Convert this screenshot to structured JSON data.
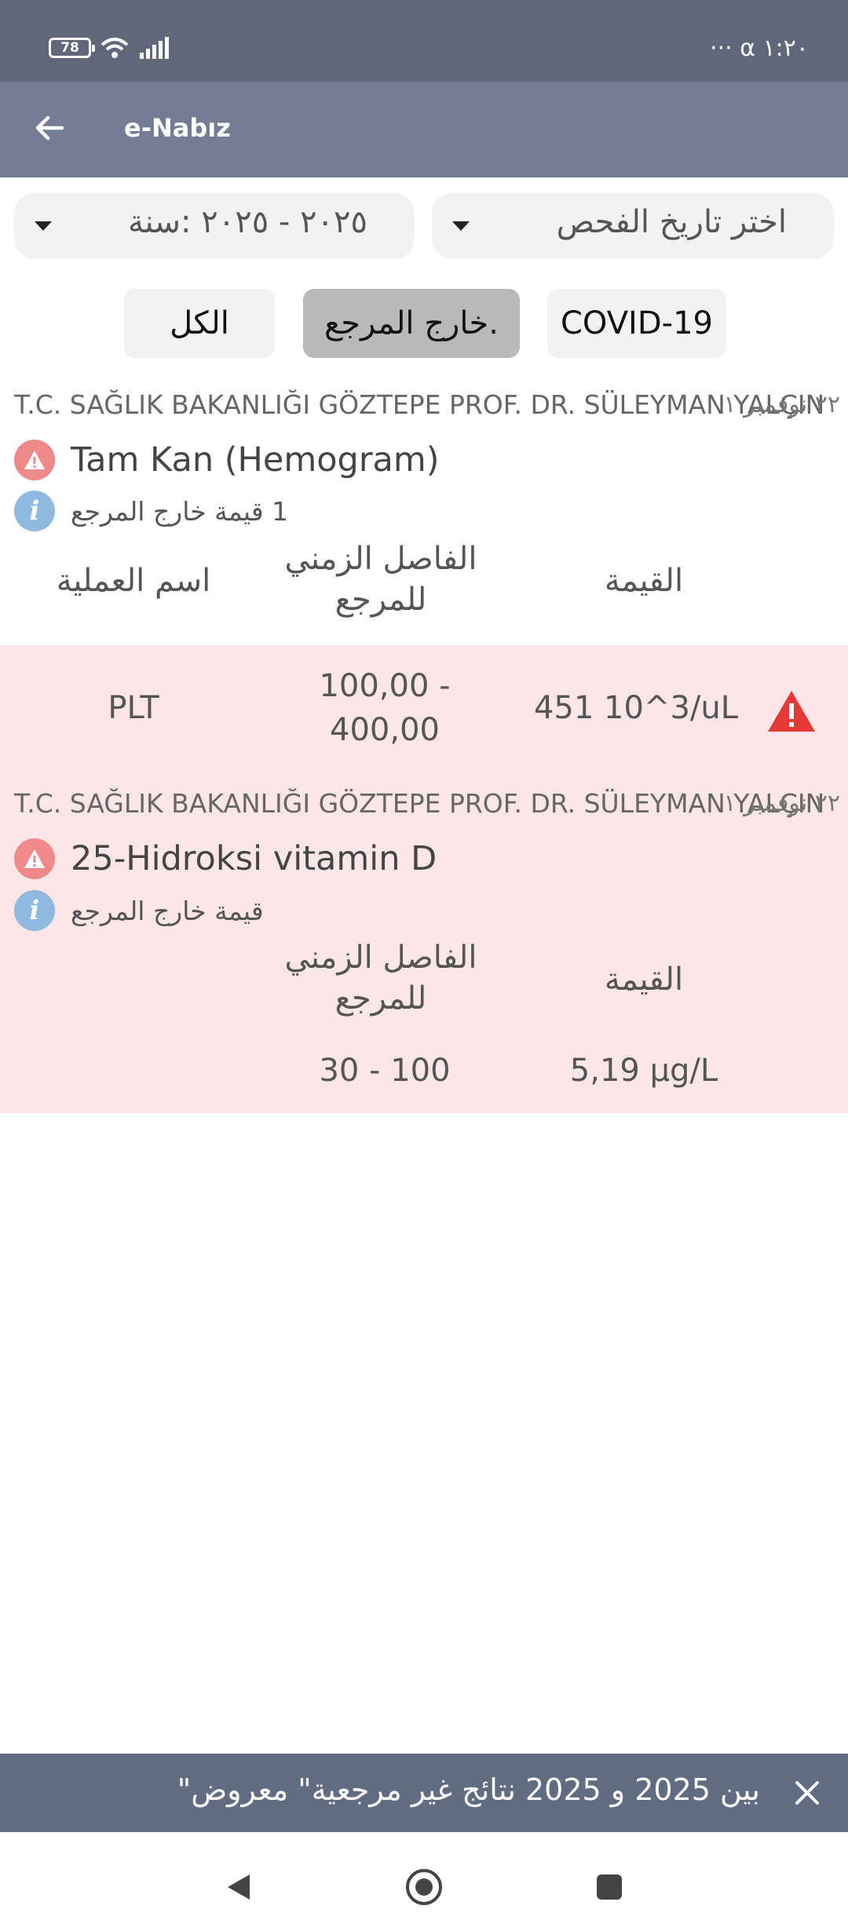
{
  "status": {
    "battery": "78",
    "time": "١:٢٠",
    "extras": "··· ⍺"
  },
  "app_bar": {
    "title": "e-Nabız"
  },
  "filters": {
    "year_dropdown": "٢٠٢٥ - ٢٠٢٥ :سنة",
    "date_dropdown": "اختر تاريخ الفحص"
  },
  "chips": {
    "all": "الكل",
    "out_of_ref": "خارج المرجع.",
    "covid": "COVID-19"
  },
  "results": [
    {
      "hospital": "T.C. SAĞLIK BAKANLIĞI GÖZTEPE PROF. DR. SÜLEYMAN YALÇIN",
      "date": "٢٢ نوفمبر ١",
      "test_name": "Tam Kan (Hemogram)",
      "info": "1 قيمة خارج المرجع",
      "headers": {
        "operation": "اسم العملية",
        "ref_range": "الفاصل الزمني للمرجع",
        "value": "القيمة"
      },
      "rows": [
        {
          "operation": "PLT",
          "ref_range": "100,00 - 400,00",
          "value": "451 10^3/uL"
        }
      ]
    },
    {
      "hospital": "T.C. SAĞLIK BAKANLIĞI GÖZTEPE PROF. DR. SÜLEYMAN YALÇIN",
      "date": "٢٢ نوفمبر ١",
      "test_name": "25-Hidroksi vitamin D",
      "info": "قيمة خارج المرجع",
      "headers": {
        "ref_range": "الفاصل الزمني للمرجع",
        "value": "القيمة"
      },
      "rows": [
        {
          "ref_range": "30 - 100",
          "value": "5,19 µg/L"
        }
      ]
    }
  ],
  "snackbar": {
    "text": "بين 2025 و 2025 نتائج غير مرجعية\" معروض\""
  },
  "colors": {
    "status_bar": "#5f6779",
    "app_bar": "#737c94",
    "alert_bg": "#fde6e7",
    "warning_red": "#e53935",
    "info_blue": "#8fb9e0"
  }
}
